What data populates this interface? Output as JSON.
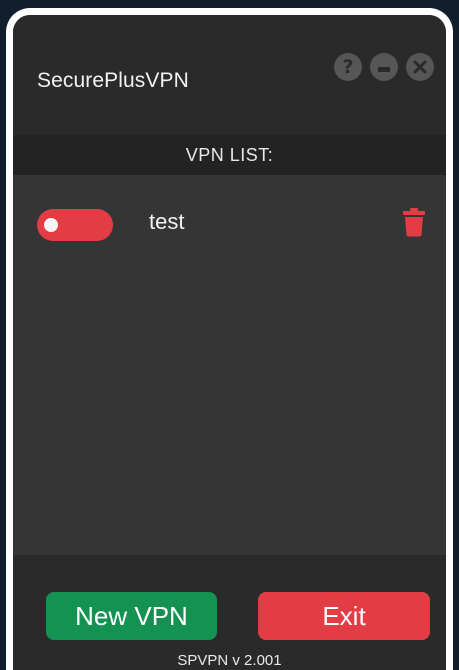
{
  "app": {
    "title": "SecurePlusVPN",
    "controls": {
      "help_glyph": "?",
      "minimize_glyph": "—",
      "close_glyph": "✕"
    }
  },
  "list": {
    "header": "VPN LIST:",
    "items": [
      {
        "name": "test",
        "enabled": false
      }
    ]
  },
  "footer": {
    "new_label": "New VPN",
    "exit_label": "Exit",
    "version": "SPVPN v 2.001"
  },
  "colors": {
    "accent_red": "#e23c45",
    "accent_green": "#139252",
    "background": "#2a2a2a",
    "list_background": "#353535"
  },
  "icons": {
    "help": "help-icon",
    "minimize": "minimize-icon",
    "close": "close-icon",
    "delete": "trash-icon"
  }
}
